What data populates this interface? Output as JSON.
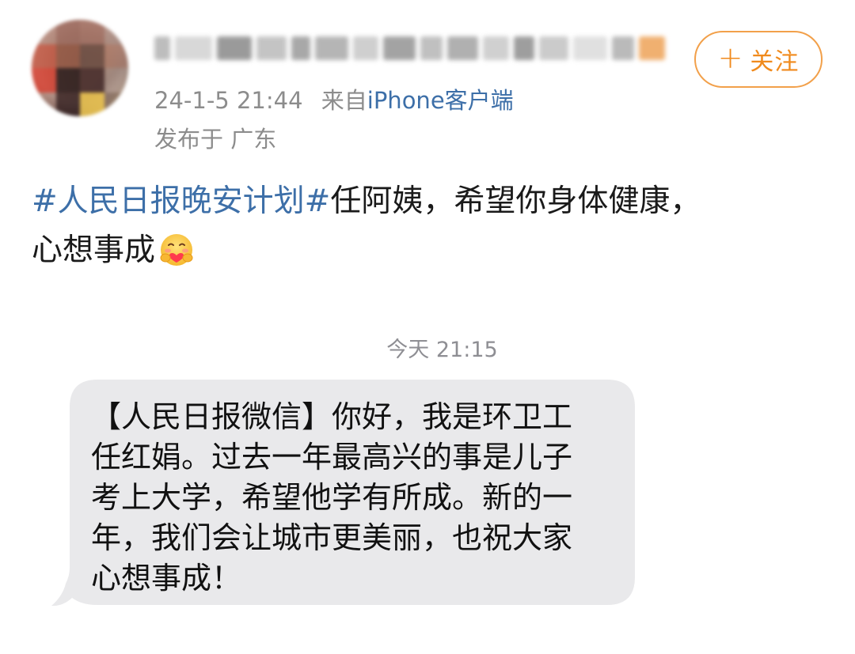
{
  "post": {
    "avatar_icon": "blurred-avatar",
    "username_icon": "blurred-username",
    "follow_button": {
      "plus": "+",
      "label": "关注"
    },
    "meta": {
      "timestamp": "24-1-5 21:44",
      "from_label": "来自",
      "source": "iPhone客户端"
    },
    "location": "发布于 广东",
    "hashtag": "#人民日报晚安计划#",
    "text_line1": "任阿姨，希望你身体健康，",
    "text_line2": "心想事成",
    "emoji": "hugging-face-emoji"
  },
  "sms": {
    "time_label": "今天 21:15",
    "lines": [
      "【人民日报微信】你好，我是环卫工",
      "任红娟。过去一年最高兴的事是儿子",
      "考上大学，希望他学有所成。新的一",
      "年，我们会让城市更美丽，也祝大家",
      "心想事成！"
    ]
  },
  "colors": {
    "link_blue": "#3d6fa8",
    "follow_orange": "#f08a1c",
    "meta_gray": "#8c8c8c",
    "bubble_gray": "#e9e9eb",
    "text_dark": "#1a1a1a"
  }
}
